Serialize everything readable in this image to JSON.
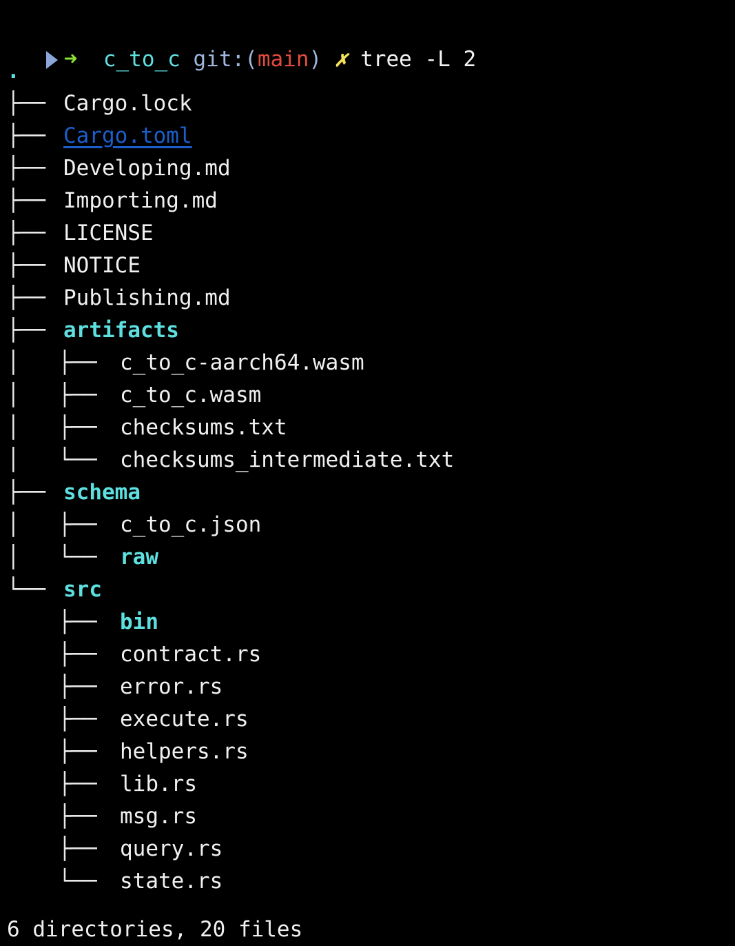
{
  "terminal": {
    "background": "#000000",
    "foreground": "#f0f0f0",
    "clipped_previous_line": " ",
    "colors": {
      "directory": "#5ee0e0",
      "file": "#f0f0f0",
      "link": "#1c5fcc",
      "branch": "#e04b3c",
      "git_prefix": "#9fb6dd",
      "dirty_marker": "#f2e05a",
      "prompt_arrow": "#8ae234",
      "prompt_head": "#8da6d9",
      "tree_lines": "#e8e8e8"
    }
  },
  "prompt": {
    "arrowhead_icon": "prompt-arrowhead-icon",
    "arrow": "➜",
    "cwd": "c_to_c",
    "git_prefix": "git:",
    "paren_open": "(",
    "branch": "main",
    "paren_close": ")",
    "dirty_marker": "✗",
    "command": "tree -L 2"
  },
  "tree": {
    "root": ".",
    "rows": [
      {
        "glyphs": "",
        "level": 0,
        "text": ".",
        "kind": "dir"
      },
      {
        "glyphs": "├──",
        "level": 1,
        "text": "Cargo.lock",
        "kind": "file"
      },
      {
        "glyphs": "├──",
        "level": 1,
        "text": "Cargo.toml",
        "kind": "link"
      },
      {
        "glyphs": "├──",
        "level": 1,
        "text": "Developing.md",
        "kind": "file"
      },
      {
        "glyphs": "├──",
        "level": 1,
        "text": "Importing.md",
        "kind": "file"
      },
      {
        "glyphs": "├──",
        "level": 1,
        "text": "LICENSE",
        "kind": "file"
      },
      {
        "glyphs": "├──",
        "level": 1,
        "text": "NOTICE",
        "kind": "file"
      },
      {
        "glyphs": "├──",
        "level": 1,
        "text": "Publishing.md",
        "kind": "file"
      },
      {
        "glyphs": "├──",
        "level": 1,
        "text": "artifacts",
        "kind": "dir"
      },
      {
        "glyphs": "│   ├──",
        "level": 2,
        "text": "c_to_c-aarch64.wasm",
        "kind": "file"
      },
      {
        "glyphs": "│   ├──",
        "level": 2,
        "text": "c_to_c.wasm",
        "kind": "file"
      },
      {
        "glyphs": "│   ├──",
        "level": 2,
        "text": "checksums.txt",
        "kind": "file"
      },
      {
        "glyphs": "│   └──",
        "level": 2,
        "text": "checksums_intermediate.txt",
        "kind": "file"
      },
      {
        "glyphs": "├──",
        "level": 1,
        "text": "schema",
        "kind": "dir"
      },
      {
        "glyphs": "│   ├──",
        "level": 2,
        "text": "c_to_c.json",
        "kind": "file"
      },
      {
        "glyphs": "│   └──",
        "level": 2,
        "text": "raw",
        "kind": "dir"
      },
      {
        "glyphs": "└──",
        "level": 1,
        "text": "src",
        "kind": "dir"
      },
      {
        "glyphs": "    ├──",
        "level": 2,
        "text": "bin",
        "kind": "dir"
      },
      {
        "glyphs": "    ├──",
        "level": 2,
        "text": "contract.rs",
        "kind": "file"
      },
      {
        "glyphs": "    ├──",
        "level": 2,
        "text": "error.rs",
        "kind": "file"
      },
      {
        "glyphs": "    ├──",
        "level": 2,
        "text": "execute.rs",
        "kind": "file"
      },
      {
        "glyphs": "    ├──",
        "level": 2,
        "text": "helpers.rs",
        "kind": "file"
      },
      {
        "glyphs": "    ├──",
        "level": 2,
        "text": "lib.rs",
        "kind": "file"
      },
      {
        "glyphs": "    ├──",
        "level": 2,
        "text": "msg.rs",
        "kind": "file"
      },
      {
        "glyphs": "    ├──",
        "level": 2,
        "text": "query.rs",
        "kind": "file"
      },
      {
        "glyphs": "    └──",
        "level": 2,
        "text": "state.rs",
        "kind": "file"
      }
    ]
  },
  "summary": {
    "text": "6 directories, 20 files",
    "directories": 6,
    "files": 20
  }
}
